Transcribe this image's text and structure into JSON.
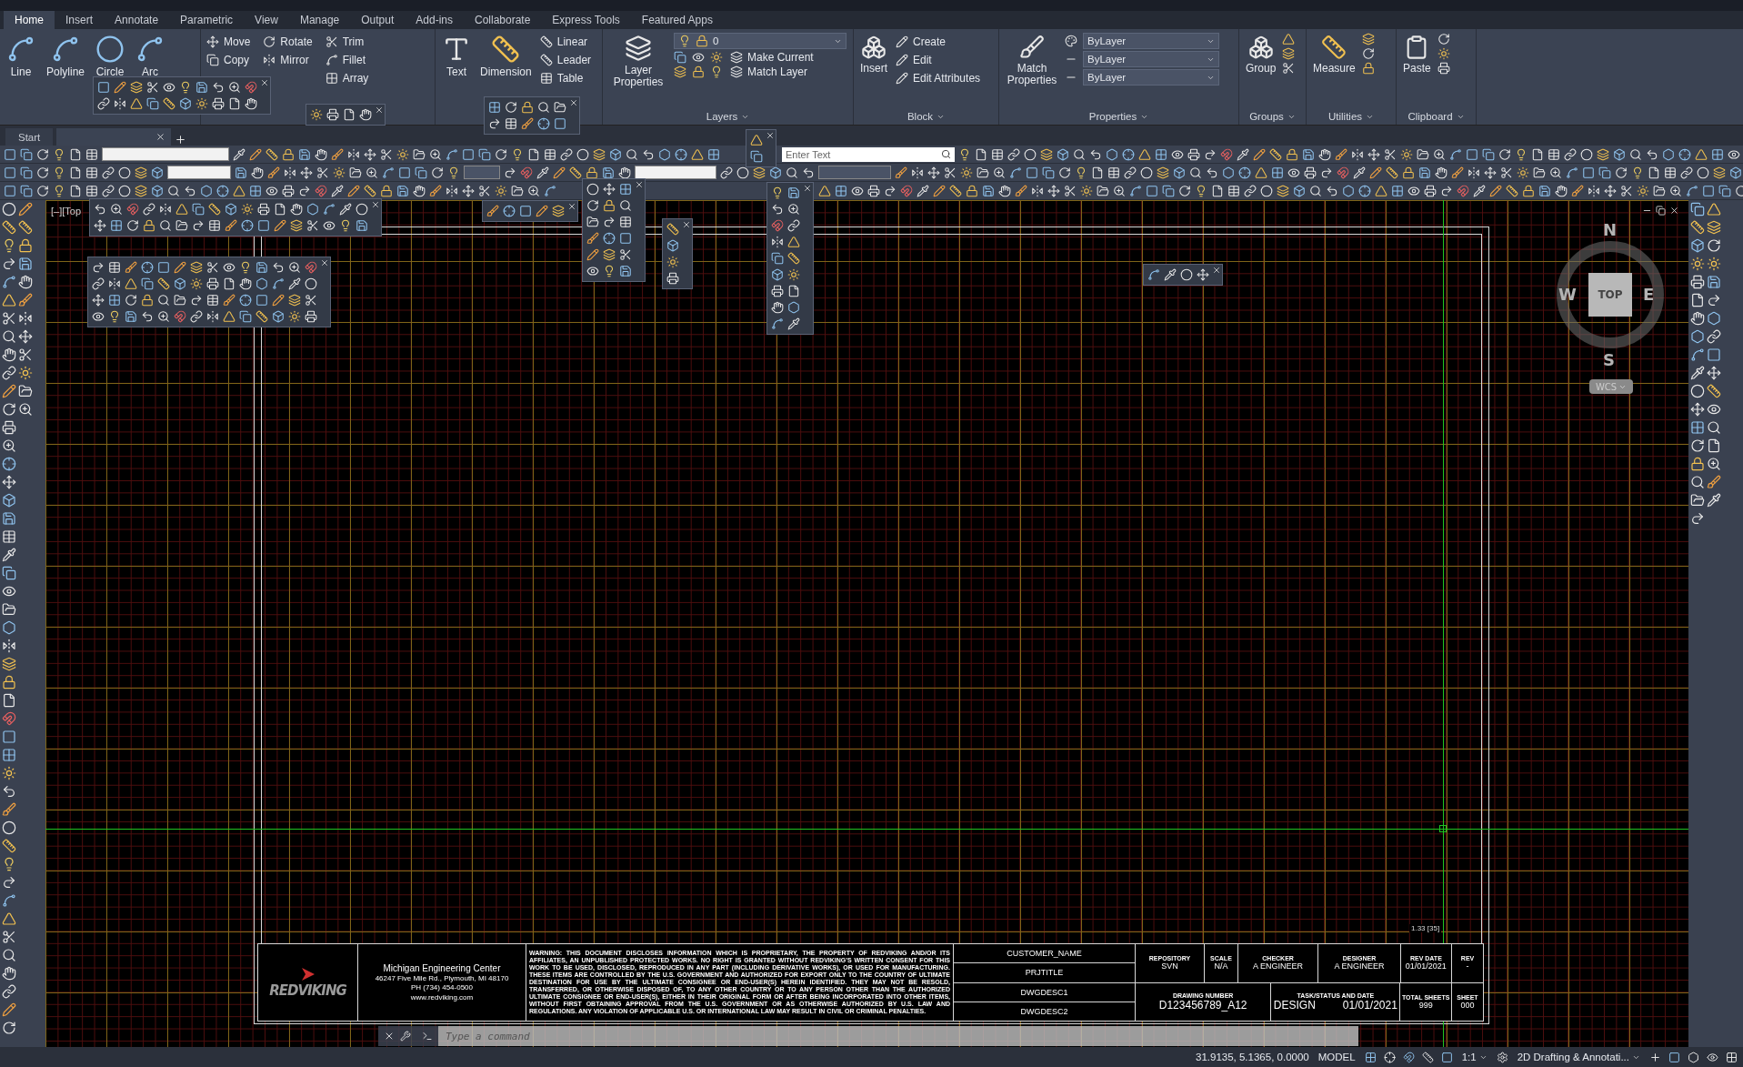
{
  "ribbon_tabs": [
    {
      "label": "Home",
      "selected": true
    },
    {
      "label": "Insert",
      "selected": false
    },
    {
      "label": "Annotate",
      "selected": false
    },
    {
      "label": "Parametric",
      "selected": false
    },
    {
      "label": "View",
      "selected": false
    },
    {
      "label": "Manage",
      "selected": false
    },
    {
      "label": "Output",
      "selected": false
    },
    {
      "label": "Add-ins",
      "selected": false
    },
    {
      "label": "Collaborate",
      "selected": false
    },
    {
      "label": "Express Tools",
      "selected": false
    },
    {
      "label": "Featured Apps",
      "selected": false
    }
  ],
  "ribbon": {
    "draw": {
      "tools": [
        {
          "label": "Line"
        },
        {
          "label": "Polyline"
        },
        {
          "label": "Circle"
        },
        {
          "label": "Arc"
        }
      ]
    },
    "modify": {
      "tools": [
        {
          "label": "Move"
        },
        {
          "label": "Rotate"
        },
        {
          "label": "Trim"
        },
        {
          "label": "Copy"
        },
        {
          "label": "Mirror"
        },
        {
          "label": "Fillet"
        },
        {
          "label": "Array"
        }
      ]
    },
    "annotation": {
      "large": [
        {
          "label": "Text"
        },
        {
          "label": "Dimension"
        }
      ],
      "small": [
        {
          "label": "Linear"
        },
        {
          "label": "Leader"
        },
        {
          "label": "Table"
        }
      ]
    },
    "layers": {
      "title": "Layers",
      "button": "Layer Properties",
      "current_layer": "0",
      "tools": [
        {
          "label": "Make Current"
        },
        {
          "label": "Match Layer"
        }
      ]
    },
    "block": {
      "title": "Block",
      "button": "Insert",
      "tools": [
        {
          "label": "Create"
        },
        {
          "label": "Edit"
        },
        {
          "label": "Edit Attributes"
        }
      ]
    },
    "properties": {
      "title": "Properties",
      "button": "Match Properties",
      "dropdowns": [
        "ByLayer",
        "ByLayer",
        "ByLayer"
      ]
    },
    "groups": {
      "title": "Groups",
      "button": "Group"
    },
    "utilities": {
      "title": "Utilities",
      "button": "Measure"
    },
    "clipboard": {
      "title": "Clipboard",
      "button": "Paste"
    }
  },
  "file_tabs": [
    {
      "label": "Start"
    }
  ],
  "search": {
    "placeholder": "Enter Text"
  },
  "viewport_label": "[–][Top",
  "viewcube": {
    "north": "N",
    "south": "S",
    "east": "E",
    "west": "W",
    "face": "TOP",
    "ucs": "WCS"
  },
  "scale_mark": "1.33 [35]",
  "title_block": {
    "logo": "REDVIKING",
    "company": [
      "Michigan Engineering Center",
      "46247 Five Mile Rd., Plymouth, MI 48170",
      "PH (734) 454-0500",
      "www.redviking.com"
    ],
    "warning": "WARNING: THIS DOCUMENT DISCLOSES INFORMATION WHICH IS PROPRIETARY, THE PROPERTY OF REDVIKING AND/OR ITS AFFILIATES, AN UNPUBLISHED PROTECTED WORKS. NO RIGHT IS GRANTED WITHOUT REDVIKING'S WRITTEN CONSENT FOR THIS WORK TO BE USED, DISCLOSED, REPRODUCED IN ANY PART (INCLUDING DERIVATIVE WORKS), OR USED FOR MANUFACTURING. THESE ITEMS ARE CONTROLLED BY THE U.S. GOVERNMENT AND AUTHORIZED FOR EXPORT ONLY TO THE COUNTRY OF ULTIMATE DESTINATION FOR USE BY THE ULTIMATE CONSIGNEE OR END-USER(S) HEREIN IDENTIFIED. THEY MAY NOT BE RESOLD, TRANSFERRED, OR OTHERWISE DISPOSED OF, TO ANY OTHER COUNTRY OR TO ANY PERSON OTHER THAN THE AUTHORIZED ULTIMATE CONSIGNEE OR END-USER(S), EITHER IN THEIR ORIGINAL FORM OR AFTER BEING INCORPORATED INTO OTHER ITEMS, WITHOUT FIRST OBTAINING APPROVAL FROM THE U.S. GOVERNMENT OR AS OTHERWISE AUTHORIZED BY U.S. LAW AND REGULATIONS. ANY VIOLATION OF APPLICABLE U.S. OR INTERNATIONAL LAW MAY RESULT IN CIVIL OR CRIMINAL PENALTIES.",
    "descriptions": [
      "CUSTOMER_NAME",
      "PRJTITLE",
      "DWGDESC1",
      "DWGDESC2"
    ],
    "fields_top": [
      {
        "label": "REPOSITORY",
        "value": "SVN"
      },
      {
        "label": "SCALE",
        "value": "N/A"
      },
      {
        "label": "CHECKER",
        "value": "A ENGINEER"
      },
      {
        "label": "DESIGNER",
        "value": "A ENGINEER"
      },
      {
        "label": "REV DATE",
        "value": "01/01/2021"
      },
      {
        "label": "REV",
        "value": "-"
      }
    ],
    "fields_bottom": [
      {
        "label": "DRAWING NUMBER",
        "value": "D123456789_A12"
      },
      {
        "label": "TASK/STATUS AND DATE",
        "value": "DESIGN",
        "date": "01/01/2021"
      },
      {
        "label": "TOTAL SHEETS",
        "value": "999"
      },
      {
        "label": "SHEET",
        "value": "000"
      }
    ]
  },
  "command_line": {
    "placeholder": "Type a command"
  },
  "status_bar": {
    "coordinates": "31.9135, 5.1365, 0.0000",
    "space": "MODEL",
    "scale": "1:1",
    "workspace": "2D Drafting & Annotati..."
  }
}
